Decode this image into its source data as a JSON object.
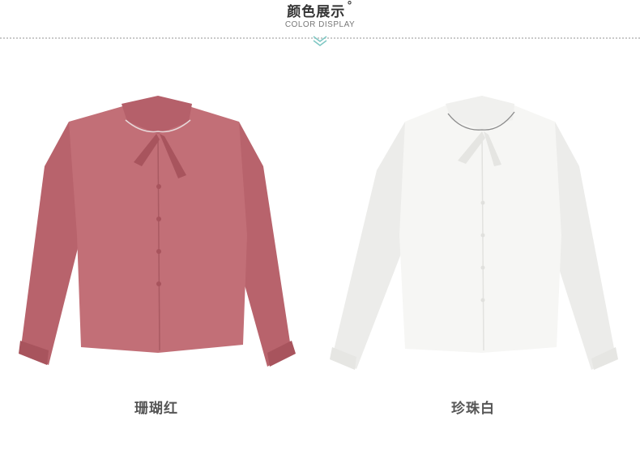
{
  "header": {
    "title": "颜色展示",
    "degree": "°",
    "subtitle": "COLOR DISPLAY"
  },
  "products": [
    {
      "label": "珊瑚红",
      "color": "#c26f77"
    },
    {
      "label": "珍珠白",
      "color": "#f6f6f4"
    }
  ],
  "colors": {
    "accent": "#7fc8c4",
    "dotline": "#c9c9c9"
  }
}
